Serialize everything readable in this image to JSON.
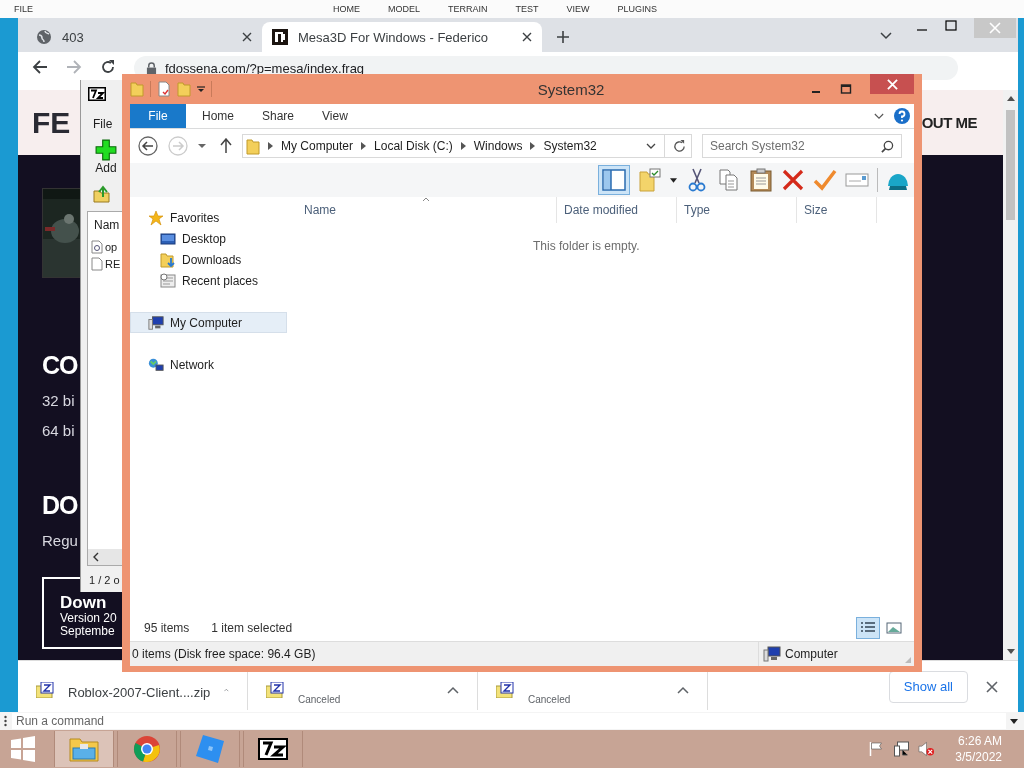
{
  "background_app": {
    "menu": [
      "FILE",
      "HOME",
      "MODEL",
      "TERRAIN",
      "TEST",
      "VIEW",
      "PLUGINS"
    ]
  },
  "browser": {
    "tabs": [
      {
        "title": "403",
        "selected": false
      },
      {
        "title": "Mesa3D For Windows - Federico",
        "selected": true
      }
    ],
    "url": "fdossena.com/?p=mesa/index.frag",
    "page": {
      "brand": "FE",
      "nav_link": "OUT ME",
      "sections": [
        {
          "kind": "heading",
          "text": "CO"
        },
        {
          "kind": "line",
          "text": "32 bi"
        },
        {
          "kind": "line",
          "text": "64 bi"
        },
        {
          "kind": "heading",
          "text": "DO"
        },
        {
          "kind": "line",
          "text": "Regu"
        }
      ],
      "download_card": {
        "title": "Down",
        "lines": [
          "Version 20",
          "Septembe"
        ]
      }
    },
    "downloads": [
      {
        "name": "Roblox-2007-Client....zip"
      },
      {
        "status": "Canceled"
      },
      {
        "status": "Canceled"
      }
    ],
    "show_all": "Show all"
  },
  "archiver": {
    "menu": [
      "File"
    ],
    "add_label": "Add",
    "column": "Nam",
    "files": [
      "op",
      "RE"
    ],
    "status": "1 / 2 o"
  },
  "explorer": {
    "title": "System32",
    "ribbon_tabs": [
      {
        "label": "File",
        "kind": "menu"
      },
      {
        "label": "Home",
        "kind": "tab"
      },
      {
        "label": "Share",
        "kind": "tab"
      },
      {
        "label": "View",
        "kind": "tab"
      }
    ],
    "path": [
      "My Computer",
      "Local Disk (C:)",
      "Windows",
      "System32"
    ],
    "search_placeholder": "Search System32",
    "layout_pane": {
      "selected": true
    },
    "nav": [
      {
        "label": "Favorites",
        "selected": false,
        "children": [
          {
            "label": "Desktop",
            "selected": false
          },
          {
            "label": "Downloads",
            "selected": false
          },
          {
            "label": "Recent places",
            "selected": false
          }
        ]
      },
      {
        "label": "My Computer",
        "selected": true
      },
      {
        "label": "Network",
        "selected": false
      }
    ],
    "columns": [
      "Name",
      "Date modified",
      "Type",
      "Size"
    ],
    "empty_text": "This folder is empty.",
    "item_count": "95 items",
    "selection": "1 item selected",
    "views": [
      {
        "selected": true
      },
      {
        "selected": false
      }
    ],
    "status": "0 items (Disk free space: 96.4 GB)",
    "location": "Computer"
  },
  "command_bar": {
    "placeholder": "Run a command"
  },
  "taskbar": {
    "apps": [
      {
        "selected": true
      },
      {
        "selected": false
      },
      {
        "selected": false
      },
      {
        "selected": false
      }
    ],
    "tray": {
      "muted": true
    },
    "time": "6:26 AM",
    "date": "3/5/2022"
  }
}
